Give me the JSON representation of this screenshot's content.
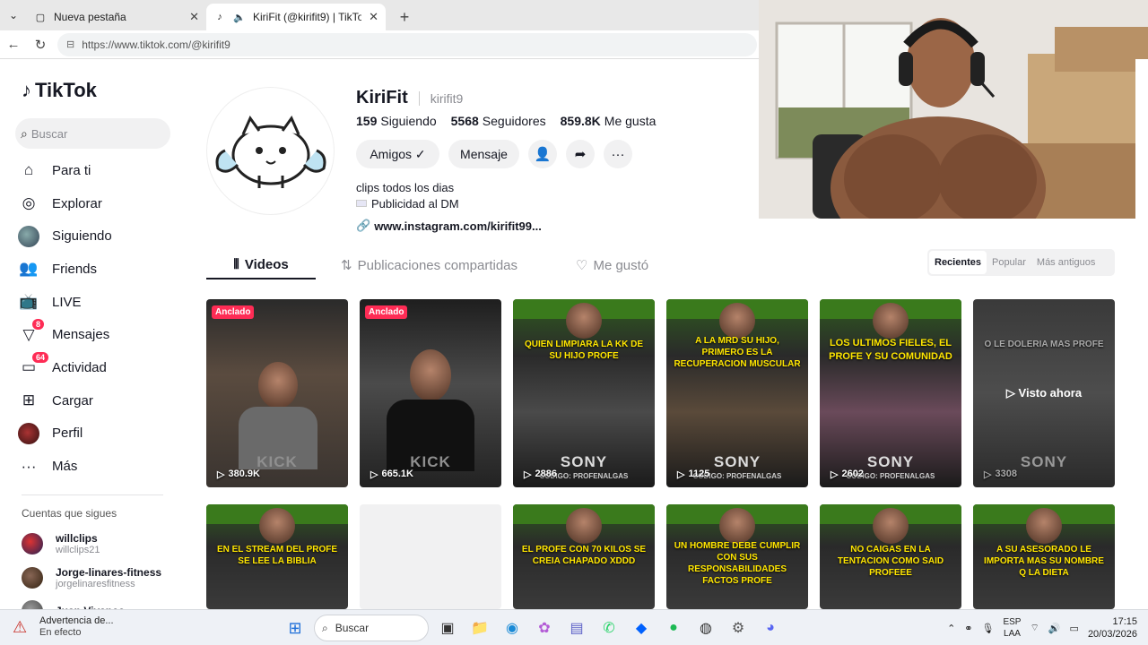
{
  "browser": {
    "tabs": [
      {
        "title": "Nueva pestaña",
        "active": false
      },
      {
        "title": "KiriFit (@kirifit9) | TikTok",
        "active": true
      }
    ],
    "url": "https://www.tiktok.com/@kirifit9"
  },
  "sidebar": {
    "brand": "TikTok",
    "search_placeholder": "Buscar",
    "items": [
      {
        "label": "Para ti",
        "icon": "home-icon"
      },
      {
        "label": "Explorar",
        "icon": "compass-icon"
      },
      {
        "label": "Siguiendo",
        "icon": "following-avatar"
      },
      {
        "label": "Friends",
        "icon": "friends-icon"
      },
      {
        "label": "LIVE",
        "icon": "live-icon"
      },
      {
        "label": "Mensajes",
        "icon": "messages-icon",
        "badge": "8"
      },
      {
        "label": "Actividad",
        "icon": "activity-icon",
        "badge": "64"
      },
      {
        "label": "Cargar",
        "icon": "upload-icon"
      },
      {
        "label": "Perfil",
        "icon": "profile-avatar"
      },
      {
        "label": "Más",
        "icon": "more-icon"
      }
    ],
    "following_heading": "Cuentas que sigues",
    "following": [
      {
        "name": "willclips",
        "handle": "willclips21"
      },
      {
        "name": "Jorge-linares-fitness",
        "handle": "jorgelinaresfitness"
      },
      {
        "name": "Juan Vivanco",
        "handle": ""
      }
    ]
  },
  "profile": {
    "name": "KiriFit",
    "username": "kirifit9",
    "following_count": "159",
    "following_label": "Siguiendo",
    "followers_count": "5568",
    "followers_label": "Seguidores",
    "likes_count": "859.8K",
    "likes_label": "Me gusta",
    "friends_label": "Amigos ✓",
    "message_label": "Mensaje",
    "bio_line1": "clips todos los dias",
    "bio_line2": "Publicidad al DM",
    "link": "www.instagram.com/kirifit99..."
  },
  "tabs": {
    "videos": "Videos",
    "reposts": "Publicaciones compartidas",
    "liked": "Me gustó"
  },
  "sort": [
    "Recientes",
    "Popular",
    "Más antiguos"
  ],
  "videos_row1": [
    {
      "pinned": "Anclado",
      "views": "380.9K",
      "caption": "",
      "brand": "KICK",
      "promo": ""
    },
    {
      "pinned": "Anclado",
      "views": "665.1K",
      "caption": "",
      "brand": "KICK",
      "promo": ""
    },
    {
      "pinned": "",
      "views": "2886",
      "caption": "QUIEN LIMPIARA LA KK DE SU HIJO PROFE",
      "brand": "SONY",
      "promo": "CÓDIGO: PROFENALGAS"
    },
    {
      "pinned": "",
      "views": "1125",
      "caption": "A LA MRD SU HIJO, PRIMERO ES LA RECUPERACION MUSCULAR",
      "brand": "SONY",
      "promo": "CÓDIGO: PROFENALGAS"
    },
    {
      "pinned": "",
      "views": "2602",
      "caption": "LOS ULTIMOS FIELES, EL PROFE Y SU COMUNIDAD",
      "brand": "SONY",
      "promo": "CÓDIGO: PROFENALGAS"
    },
    {
      "pinned": "",
      "views": "3308",
      "caption": "O LE DOLERIA MAS PROFE",
      "brand": "SONY",
      "promo": "",
      "watched": "▷ Visto ahora"
    }
  ],
  "videos_row2": [
    {
      "caption": "EN EL STREAM DEL PROFE SE LEE LA BIBLIA"
    },
    {
      "caption": ""
    },
    {
      "caption": "EL PROFE CON 70 KILOS SE CREIA CHAPADO XDDD"
    },
    {
      "caption": "UN HOMBRE DEBE CUMPLIR CON SUS RESPONSABILIDADES FACTOS PROFE"
    },
    {
      "caption": "NO CAIGAS EN LA TENTACION COMO SAID PROFEEE"
    },
    {
      "caption": "A SU ASESORADO LE IMPORTA MAS SU NOMBRE Q LA DIETA"
    }
  ],
  "taskbar": {
    "warning_title": "Advertencia de...",
    "warning_sub": "En efecto",
    "search": "Buscar",
    "lang1": "ESP",
    "lang2": "LAA",
    "time": "17:15",
    "date": "20/03/2026"
  },
  "colors": {
    "accent": "#fe2c55",
    "caption_yellow": "#ffe600"
  }
}
